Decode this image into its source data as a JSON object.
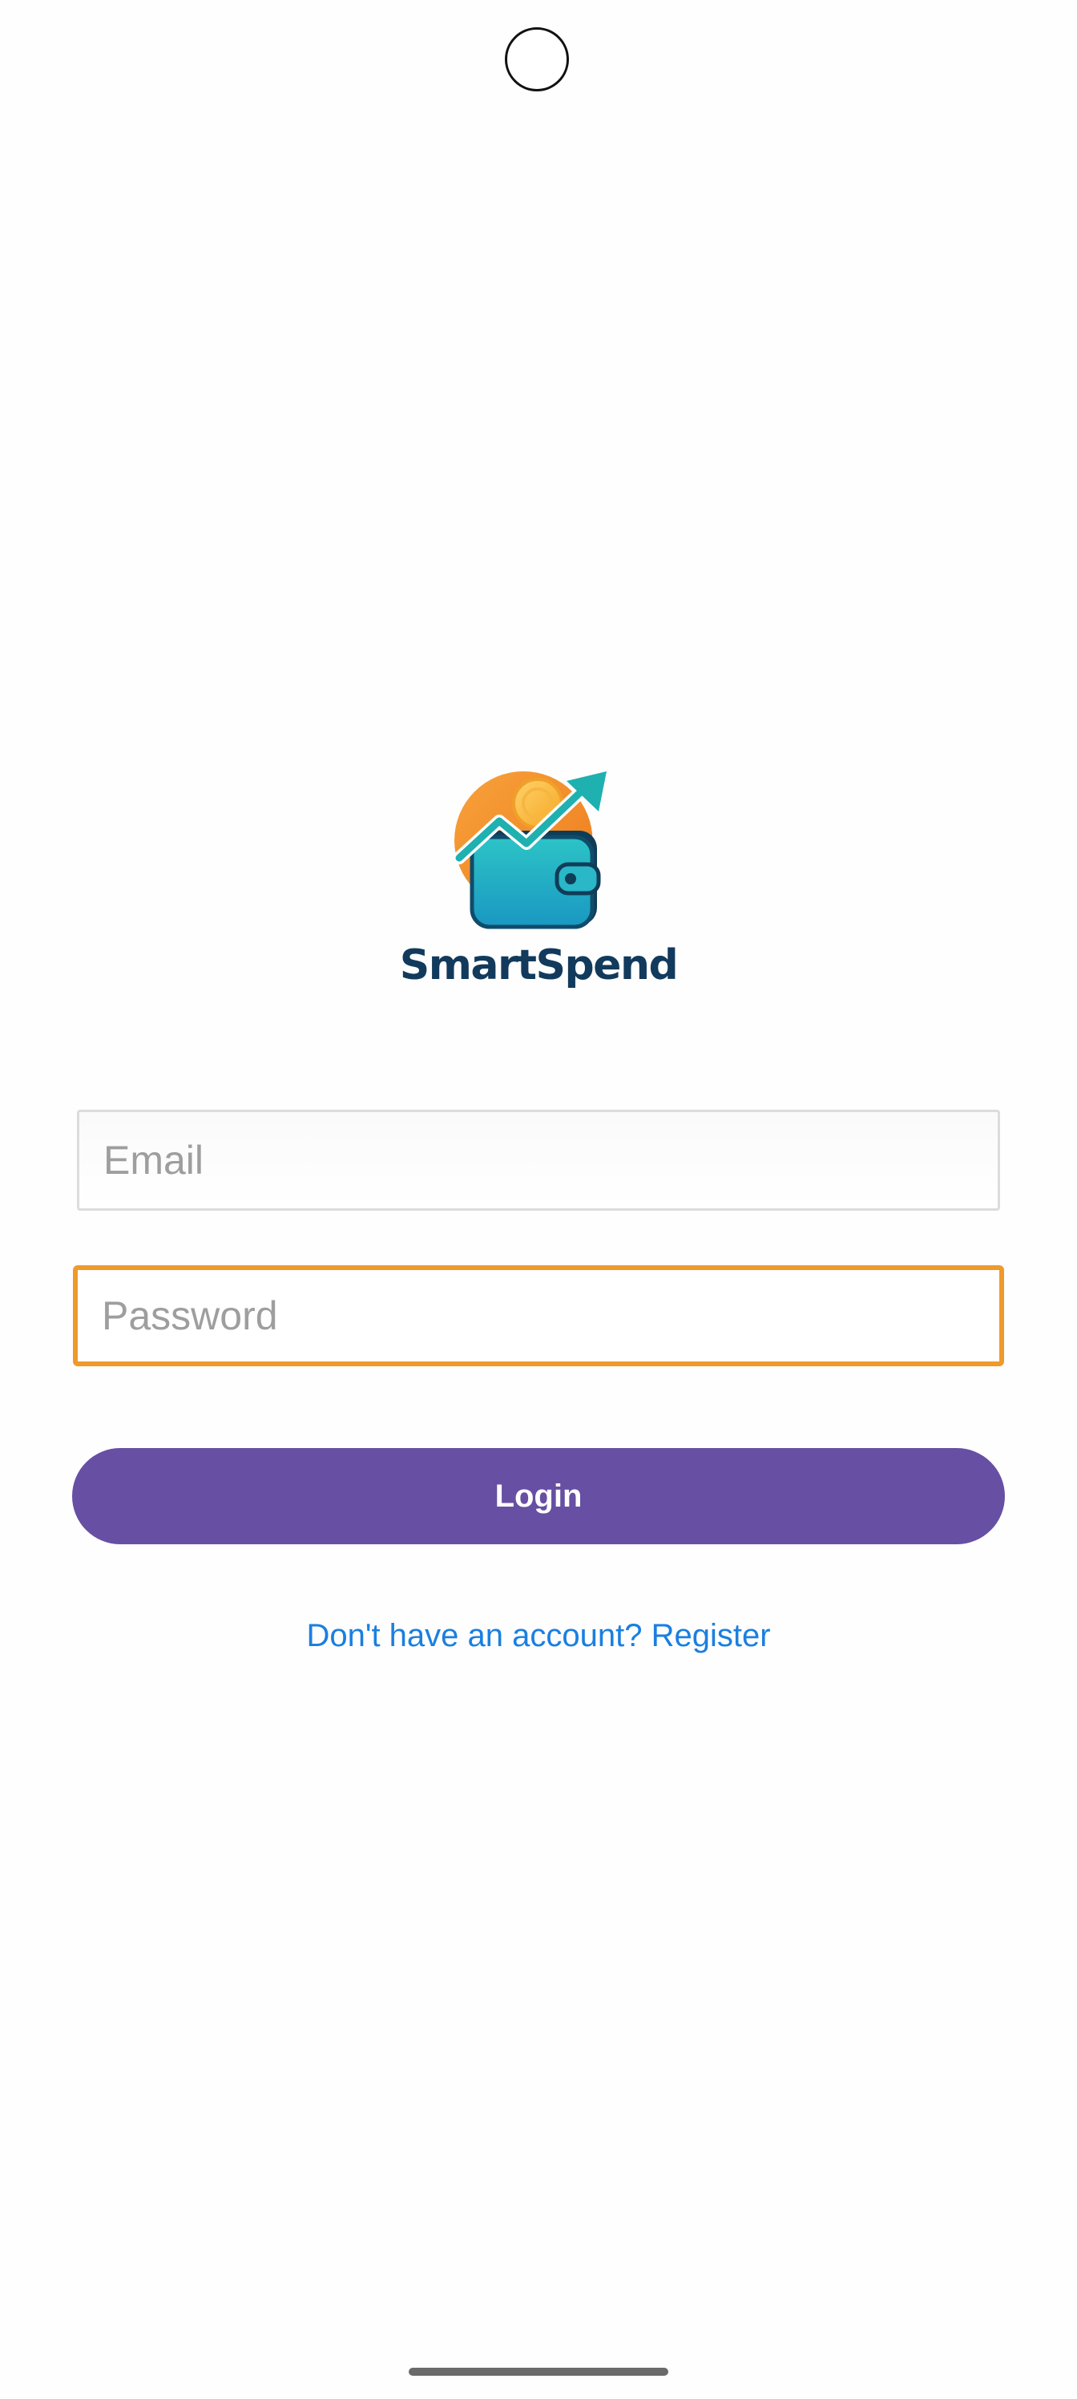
{
  "app": {
    "name": "SmartSpend"
  },
  "logo": {
    "icon": "wallet-growth-icon",
    "text": "SmartSpend"
  },
  "form": {
    "email": {
      "placeholder": "Email",
      "value": ""
    },
    "password": {
      "placeholder": "Password",
      "value": "",
      "focused": true
    },
    "login_label": "Login",
    "register_link": "Don't have an account? Register"
  },
  "colors": {
    "brand_text": "#123a5c",
    "primary_button": "#674fa3",
    "focus_border": "#ef9a2b",
    "link": "#1a7fe0",
    "placeholder": "#9e9e9e"
  }
}
